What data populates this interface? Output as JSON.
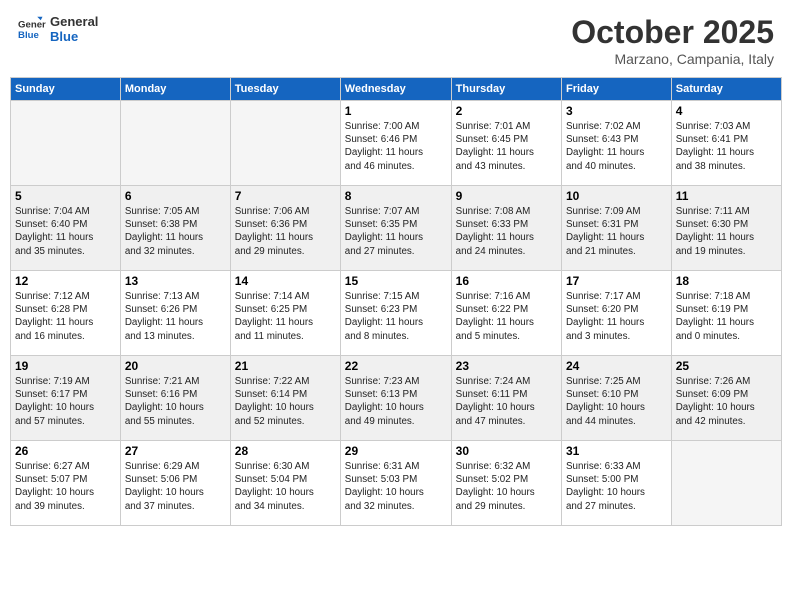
{
  "header": {
    "logo_general": "General",
    "logo_blue": "Blue",
    "month_title": "October 2025",
    "location": "Marzano, Campania, Italy"
  },
  "weekdays": [
    "Sunday",
    "Monday",
    "Tuesday",
    "Wednesday",
    "Thursday",
    "Friday",
    "Saturday"
  ],
  "weeks": [
    [
      {
        "day": "",
        "text": ""
      },
      {
        "day": "",
        "text": ""
      },
      {
        "day": "",
        "text": ""
      },
      {
        "day": "1",
        "text": "Sunrise: 7:00 AM\nSunset: 6:46 PM\nDaylight: 11 hours\nand 46 minutes."
      },
      {
        "day": "2",
        "text": "Sunrise: 7:01 AM\nSunset: 6:45 PM\nDaylight: 11 hours\nand 43 minutes."
      },
      {
        "day": "3",
        "text": "Sunrise: 7:02 AM\nSunset: 6:43 PM\nDaylight: 11 hours\nand 40 minutes."
      },
      {
        "day": "4",
        "text": "Sunrise: 7:03 AM\nSunset: 6:41 PM\nDaylight: 11 hours\nand 38 minutes."
      }
    ],
    [
      {
        "day": "5",
        "text": "Sunrise: 7:04 AM\nSunset: 6:40 PM\nDaylight: 11 hours\nand 35 minutes."
      },
      {
        "day": "6",
        "text": "Sunrise: 7:05 AM\nSunset: 6:38 PM\nDaylight: 11 hours\nand 32 minutes."
      },
      {
        "day": "7",
        "text": "Sunrise: 7:06 AM\nSunset: 6:36 PM\nDaylight: 11 hours\nand 29 minutes."
      },
      {
        "day": "8",
        "text": "Sunrise: 7:07 AM\nSunset: 6:35 PM\nDaylight: 11 hours\nand 27 minutes."
      },
      {
        "day": "9",
        "text": "Sunrise: 7:08 AM\nSunset: 6:33 PM\nDaylight: 11 hours\nand 24 minutes."
      },
      {
        "day": "10",
        "text": "Sunrise: 7:09 AM\nSunset: 6:31 PM\nDaylight: 11 hours\nand 21 minutes."
      },
      {
        "day": "11",
        "text": "Sunrise: 7:11 AM\nSunset: 6:30 PM\nDaylight: 11 hours\nand 19 minutes."
      }
    ],
    [
      {
        "day": "12",
        "text": "Sunrise: 7:12 AM\nSunset: 6:28 PM\nDaylight: 11 hours\nand 16 minutes."
      },
      {
        "day": "13",
        "text": "Sunrise: 7:13 AM\nSunset: 6:26 PM\nDaylight: 11 hours\nand 13 minutes."
      },
      {
        "day": "14",
        "text": "Sunrise: 7:14 AM\nSunset: 6:25 PM\nDaylight: 11 hours\nand 11 minutes."
      },
      {
        "day": "15",
        "text": "Sunrise: 7:15 AM\nSunset: 6:23 PM\nDaylight: 11 hours\nand 8 minutes."
      },
      {
        "day": "16",
        "text": "Sunrise: 7:16 AM\nSunset: 6:22 PM\nDaylight: 11 hours\nand 5 minutes."
      },
      {
        "day": "17",
        "text": "Sunrise: 7:17 AM\nSunset: 6:20 PM\nDaylight: 11 hours\nand 3 minutes."
      },
      {
        "day": "18",
        "text": "Sunrise: 7:18 AM\nSunset: 6:19 PM\nDaylight: 11 hours\nand 0 minutes."
      }
    ],
    [
      {
        "day": "19",
        "text": "Sunrise: 7:19 AM\nSunset: 6:17 PM\nDaylight: 10 hours\nand 57 minutes."
      },
      {
        "day": "20",
        "text": "Sunrise: 7:21 AM\nSunset: 6:16 PM\nDaylight: 10 hours\nand 55 minutes."
      },
      {
        "day": "21",
        "text": "Sunrise: 7:22 AM\nSunset: 6:14 PM\nDaylight: 10 hours\nand 52 minutes."
      },
      {
        "day": "22",
        "text": "Sunrise: 7:23 AM\nSunset: 6:13 PM\nDaylight: 10 hours\nand 49 minutes."
      },
      {
        "day": "23",
        "text": "Sunrise: 7:24 AM\nSunset: 6:11 PM\nDaylight: 10 hours\nand 47 minutes."
      },
      {
        "day": "24",
        "text": "Sunrise: 7:25 AM\nSunset: 6:10 PM\nDaylight: 10 hours\nand 44 minutes."
      },
      {
        "day": "25",
        "text": "Sunrise: 7:26 AM\nSunset: 6:09 PM\nDaylight: 10 hours\nand 42 minutes."
      }
    ],
    [
      {
        "day": "26",
        "text": "Sunrise: 6:27 AM\nSunset: 5:07 PM\nDaylight: 10 hours\nand 39 minutes."
      },
      {
        "day": "27",
        "text": "Sunrise: 6:29 AM\nSunset: 5:06 PM\nDaylight: 10 hours\nand 37 minutes."
      },
      {
        "day": "28",
        "text": "Sunrise: 6:30 AM\nSunset: 5:04 PM\nDaylight: 10 hours\nand 34 minutes."
      },
      {
        "day": "29",
        "text": "Sunrise: 6:31 AM\nSunset: 5:03 PM\nDaylight: 10 hours\nand 32 minutes."
      },
      {
        "day": "30",
        "text": "Sunrise: 6:32 AM\nSunset: 5:02 PM\nDaylight: 10 hours\nand 29 minutes."
      },
      {
        "day": "31",
        "text": "Sunrise: 6:33 AM\nSunset: 5:00 PM\nDaylight: 10 hours\nand 27 minutes."
      },
      {
        "day": "",
        "text": ""
      }
    ]
  ]
}
